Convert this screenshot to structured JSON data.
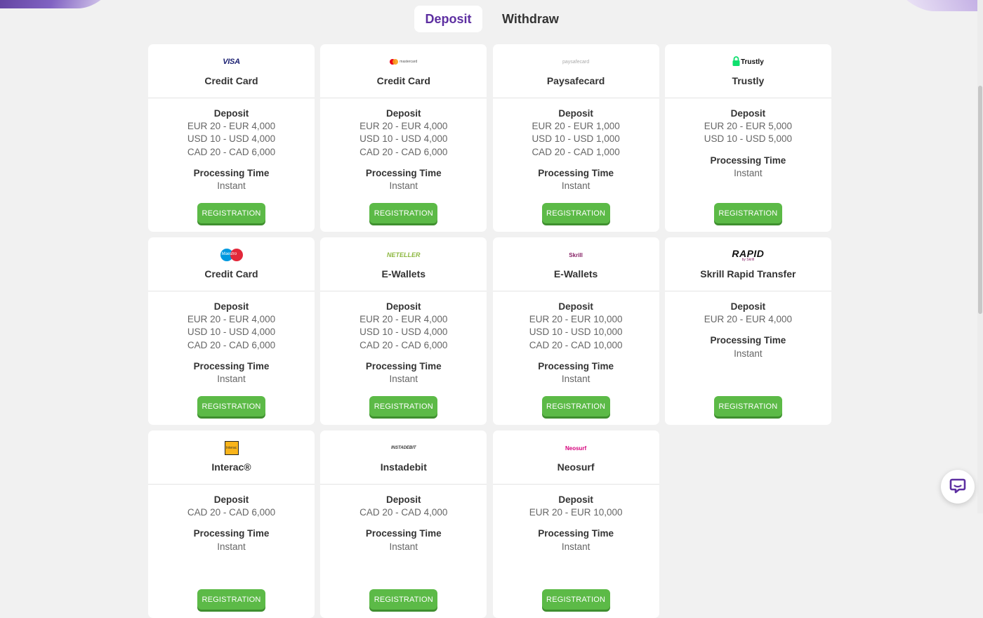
{
  "tabs": {
    "deposit": "Deposit",
    "withdraw": "Withdraw"
  },
  "colors": {
    "accent": "#5d2fa1",
    "button": "#5cba47"
  },
  "labels": {
    "deposit": "Deposit",
    "processing": "Processing Time",
    "button": "REGISTRATION"
  },
  "methods": [
    {
      "logo": "VISA",
      "name": "Credit Card",
      "limits": [
        "EUR 20 - EUR 4,000",
        "USD 10 - USD 4,000",
        "CAD 20 - CAD 6,000"
      ],
      "time": "Instant"
    },
    {
      "logo": "mastercard",
      "name": "Credit Card",
      "limits": [
        "EUR 20 - EUR 4,000",
        "USD 10 - USD 4,000",
        "CAD 20 - CAD 6,000"
      ],
      "time": "Instant"
    },
    {
      "logo": "paysafecard",
      "name": "Paysafecard",
      "limits": [
        "EUR 20 - EUR 1,000",
        "USD 10 - USD 1,000",
        "CAD 20 - CAD 1,000"
      ],
      "time": "Instant"
    },
    {
      "logo": "Trustly",
      "name": "Trustly",
      "limits": [
        "EUR 20 - EUR 5,000",
        "USD 10 - USD 5,000"
      ],
      "time": "Instant"
    },
    {
      "logo": "Maestro",
      "name": "Credit Card",
      "limits": [
        "EUR 20 - EUR 4,000",
        "USD 10 - USD 4,000",
        "CAD 20 - CAD 6,000"
      ],
      "time": "Instant"
    },
    {
      "logo": "NETELLER",
      "name": "E-Wallets",
      "limits": [
        "EUR 20 - EUR 4,000",
        "USD 10 - USD 4,000",
        "CAD 20 - CAD 6,000"
      ],
      "time": "Instant"
    },
    {
      "logo": "Skrill",
      "name": "E-Wallets",
      "limits": [
        "EUR 20 - EUR 10,000",
        "USD 10 - USD 10,000",
        "CAD 20 - CAD 10,000"
      ],
      "time": "Instant"
    },
    {
      "logo": "RAPID",
      "logo_sub": "by Skrill",
      "name": "Skrill Rapid Transfer",
      "limits": [
        "EUR 20 - EUR 4,000"
      ],
      "time": "Instant"
    },
    {
      "logo": "Interac",
      "name": "Interac®",
      "limits": [
        "CAD 20 - CAD 6,000"
      ],
      "time": "Instant"
    },
    {
      "logo": "INSTADEBIT",
      "name": "Instadebit",
      "limits": [
        "CAD 20 - CAD 4,000"
      ],
      "time": "Instant"
    },
    {
      "logo": "Neosurf",
      "name": "Neosurf",
      "limits": [
        "EUR 20 - EUR 10,000"
      ],
      "time": "Instant"
    }
  ],
  "chat": {
    "icon": "chat-bubble-icon"
  }
}
